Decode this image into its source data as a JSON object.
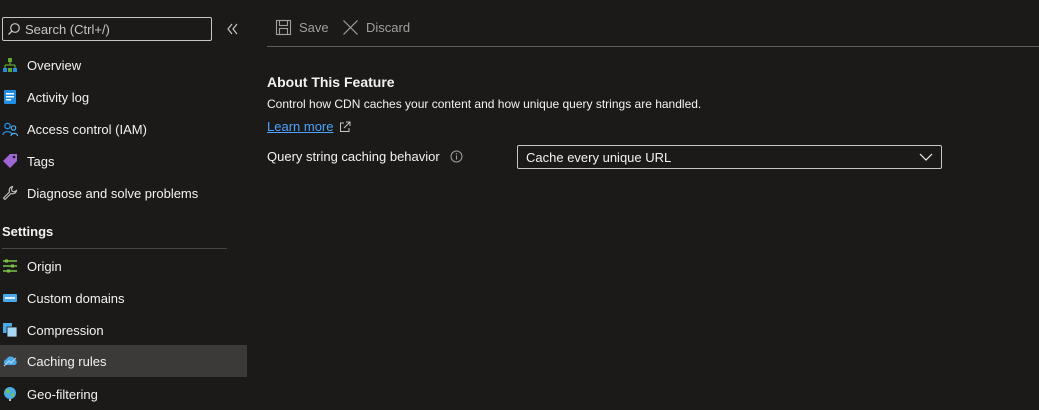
{
  "sidebar": {
    "search": {
      "placeholder": "Search (Ctrl+/)",
      "value": ""
    },
    "items": [
      {
        "label": "Overview",
        "icon": "overview-icon",
        "color": "#5ea72e"
      },
      {
        "label": "Activity log",
        "icon": "activity-log-icon",
        "color": "#1f8ee3"
      },
      {
        "label": "Access control (IAM)",
        "icon": "access-control-icon",
        "color": "#1f8ee3"
      },
      {
        "label": "Tags",
        "icon": "tag-icon",
        "color": "#a067d4"
      },
      {
        "label": "Diagnose and solve problems",
        "icon": "wrench-icon",
        "color": "#c8c6c4"
      }
    ],
    "settings_header": "Settings",
    "settings_items": [
      {
        "label": "Origin",
        "icon": "origin-icon",
        "color": "#7bc443",
        "selected": false
      },
      {
        "label": "Custom domains",
        "icon": "custom-domains-icon",
        "color": "#4aa9e8",
        "selected": false
      },
      {
        "label": "Compression",
        "icon": "compression-icon",
        "color": "#4aa9e8",
        "selected": false
      },
      {
        "label": "Caching rules",
        "icon": "caching-rules-icon",
        "color": "#4aa9e8",
        "selected": true
      },
      {
        "label": "Geo-filtering",
        "icon": "globe-icon",
        "color": "#4aa9e8",
        "selected": false
      }
    ]
  },
  "toolbar": {
    "save_label": "Save",
    "discard_label": "Discard"
  },
  "feature": {
    "title": "About This Feature",
    "description": "Control how CDN caches your content and how unique query strings are handled.",
    "learn_more": "Learn more"
  },
  "query_string": {
    "label": "Query string caching behavior",
    "selected": "Cache every unique URL"
  },
  "colors": {
    "background": "#1b1a19",
    "selected_row": "#3b3a39",
    "link": "#4da3ff",
    "text": "#f3f2f1"
  }
}
